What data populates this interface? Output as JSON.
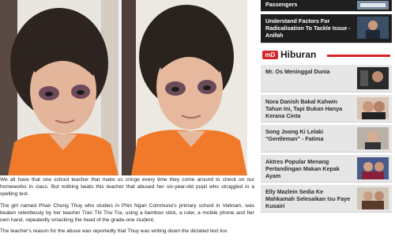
{
  "article": {
    "paragraphs": [
      "We all have that one school teacher that make us cringe every time they come around to check on our homeworks in class. But nothing beats this teacher that abused her six-year-old pupil who struggled in a spelling test.",
      "The girl named Phan Chung Thuy who studies in Phin Ngan Commune's primary school in Vietnam, was beaten relentlessly by her teacher Tran Thi Thu Tra, using a bamboo stick, a ruler, a mobile phone and her own hand, repeatedly smacking the head of the grade-one student.",
      "The teacher's reason for the abuse was reportedly that Thuy was writing down the dictated text too"
    ]
  },
  "sidebar": {
    "top_items": [
      {
        "label": "Passengers"
      },
      {
        "label": "Understand Factors For Radicalisation To Tackle Issue - Anifah"
      }
    ],
    "section": {
      "logo": "mD",
      "title": "Hiburan"
    },
    "items": [
      {
        "label": "Mr. Os Meninggal Dunia"
      },
      {
        "label": "Nora Danish Bakal Kahwin Tahun Ini, Tapi Bukan Hanya Kerana Cinta"
      },
      {
        "label": "Song Joong Ki Lelaki \"Gentleman\" - Fatima"
      },
      {
        "label": "Aktres Popular Menang Pertandingan Makan Kepak Ayam"
      },
      {
        "label": "Elly Mazlein Sedia Ke Mahkamah Selesaikan Isu Faye Kusairi"
      }
    ]
  },
  "colors": {
    "accent": "#d8232a",
    "dark_item": "#1f1f1f",
    "light_item": "#e6e6e6"
  }
}
